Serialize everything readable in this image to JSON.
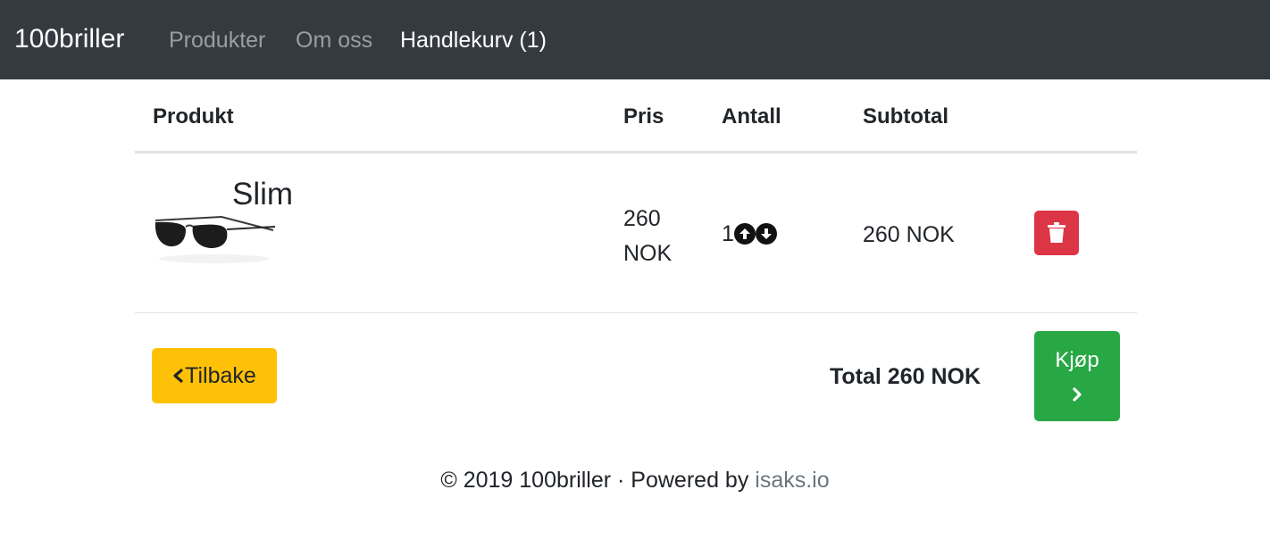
{
  "navbar": {
    "brand": "100briller",
    "links": [
      {
        "label": "Produkter"
      },
      {
        "label": "Om oss"
      },
      {
        "label": "Handlekurv (1)"
      }
    ]
  },
  "table": {
    "headers": [
      "Produkt",
      "Pris",
      "Antall",
      "Subtotal"
    ],
    "rows": [
      {
        "name": "Slim",
        "price": "260 NOK",
        "quantity": "1",
        "subtotal": "260 NOK"
      }
    ]
  },
  "actions": {
    "back_label": "Tilbake",
    "total": "Total 260 NOK",
    "buy_label": "Kjøp"
  },
  "footer": {
    "copyright": "© 2019 100briller · Powered by ",
    "powered_link": "isaks.io"
  },
  "icons": {
    "increase": "arrow-circle-up-icon",
    "decrease": "arrow-circle-down-icon",
    "delete": "trash-icon",
    "back": "chevron-left-icon",
    "buy": "chevron-right-icon"
  },
  "colors": {
    "navbar": "#343a40",
    "danger": "#dc3545",
    "warning": "#ffc107",
    "success": "#28a745",
    "muted_link": "#6c757d"
  }
}
